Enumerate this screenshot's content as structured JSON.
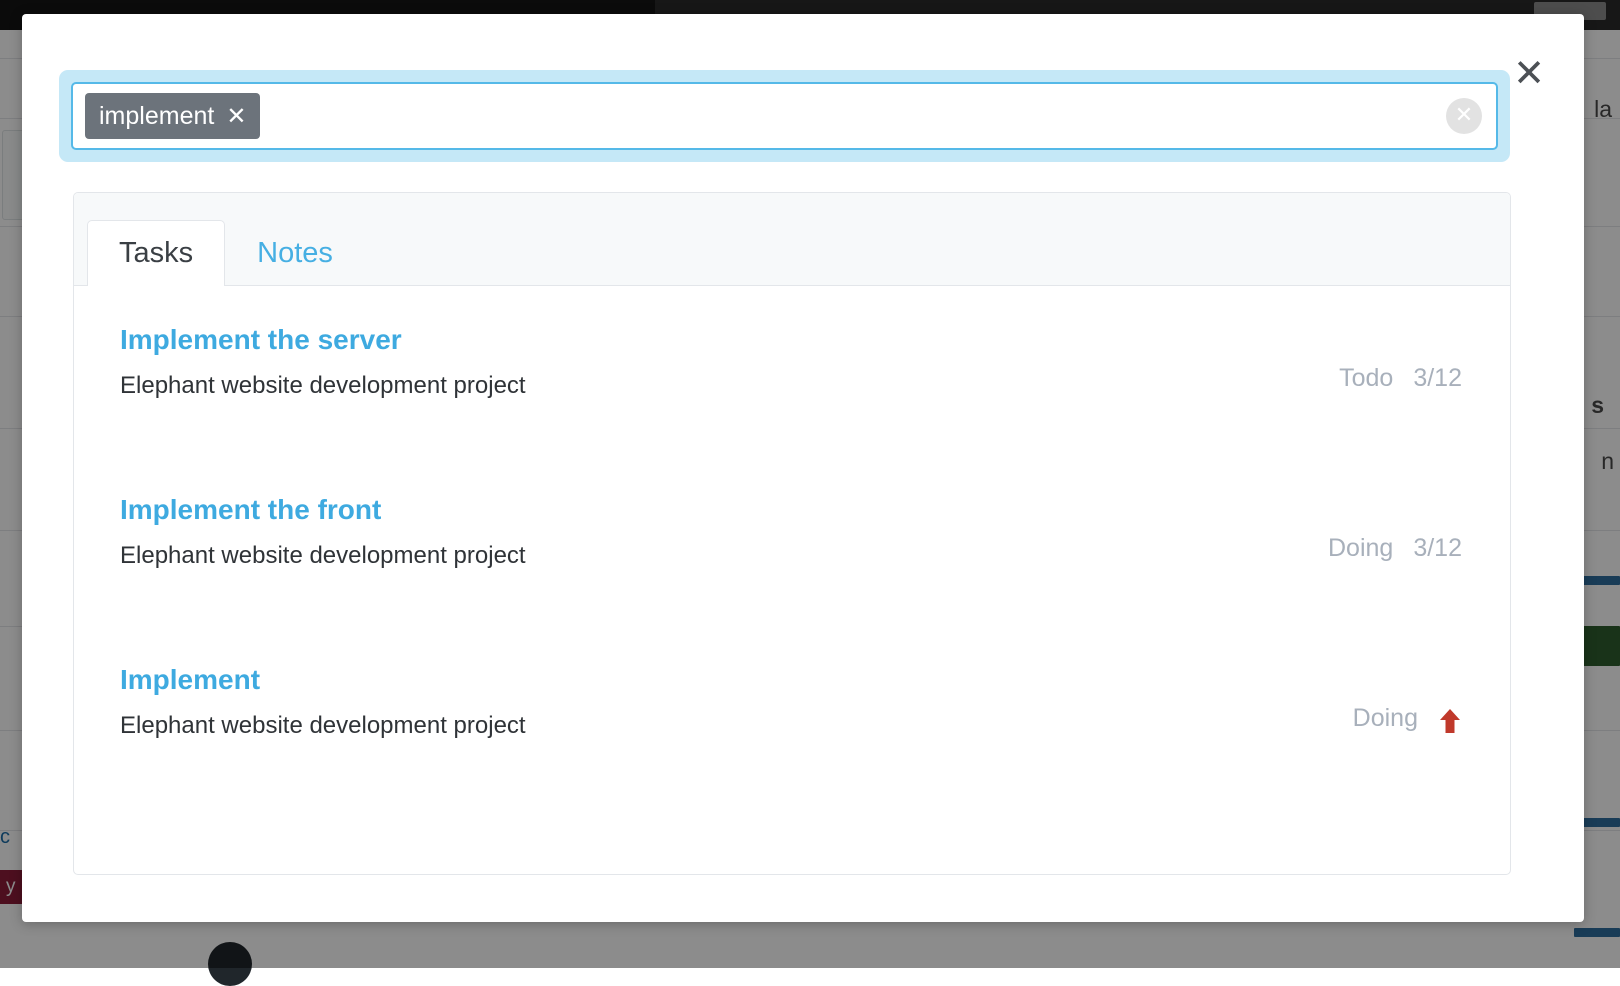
{
  "background": {
    "topbar": {
      "present": true
    },
    "labels": {
      "right_partial_1": "la",
      "right_partial_2": "s",
      "right_partial_3": "n",
      "left_link_partial": "c",
      "left_tag_partial": "y"
    },
    "bar_colors": {
      "green": "#2f5d2f",
      "blue": "#2f6d9e",
      "dark_red": "#8c1d3a"
    }
  },
  "modal": {
    "close_icon": "close-icon",
    "close_label": "✕"
  },
  "search": {
    "token_label": "implement",
    "token_remove_icon": "✕",
    "input_value": "",
    "placeholder": "",
    "clear_icon": "✕"
  },
  "tabs": [
    {
      "label": "Tasks",
      "active": true
    },
    {
      "label": "Notes",
      "active": false
    }
  ],
  "results": [
    {
      "title": "Implement the server",
      "project": "Elephant website development project",
      "status": "Todo",
      "date": "3/12",
      "priority": null
    },
    {
      "title": "Implement the front",
      "project": "Elephant website development project",
      "status": "Doing",
      "date": "3/12",
      "priority": null
    },
    {
      "title": "Implement",
      "project": "Elephant website development project",
      "status": "Doing",
      "date": "",
      "priority": "high-priority-arrow-icon"
    }
  ],
  "colors": {
    "accent_blue": "#3eaae0",
    "focus_glow": "#c5e8f7",
    "token_gray": "#6c737b",
    "meta_gray": "#a8b0bb",
    "priority_red": "#c0392b"
  }
}
